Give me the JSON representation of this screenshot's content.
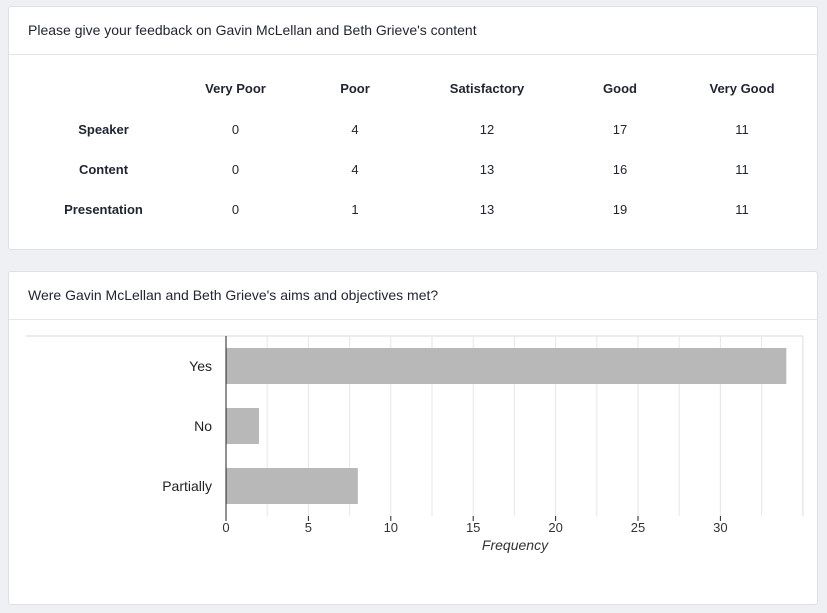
{
  "feedback": {
    "title": "Please give your feedback on Gavin McLellan and Beth Grieve's content",
    "columns": [
      "Very Poor",
      "Poor",
      "Satisfactory",
      "Good",
      "Very Good"
    ],
    "rows": [
      {
        "label": "Speaker",
        "values": [
          "0",
          "4",
          "12",
          "17",
          "11"
        ]
      },
      {
        "label": "Content",
        "values": [
          "0",
          "4",
          "13",
          "16",
          "11"
        ]
      },
      {
        "label": "Presentation",
        "values": [
          "0",
          "1",
          "13",
          "19",
          "11"
        ]
      }
    ]
  },
  "aims": {
    "title": "Were Gavin McLellan and Beth Grieve's aims and objectives met?"
  },
  "chart_data": {
    "type": "bar",
    "orientation": "horizontal",
    "categories": [
      "Yes",
      "No",
      "Partially"
    ],
    "values": [
      34,
      2,
      8
    ],
    "xlabel": "Frequency",
    "xlim": [
      0,
      35
    ],
    "xticks": [
      0,
      5,
      10,
      15,
      20,
      25,
      30
    ],
    "grid": true,
    "bar_color": "#b8b8b8"
  }
}
